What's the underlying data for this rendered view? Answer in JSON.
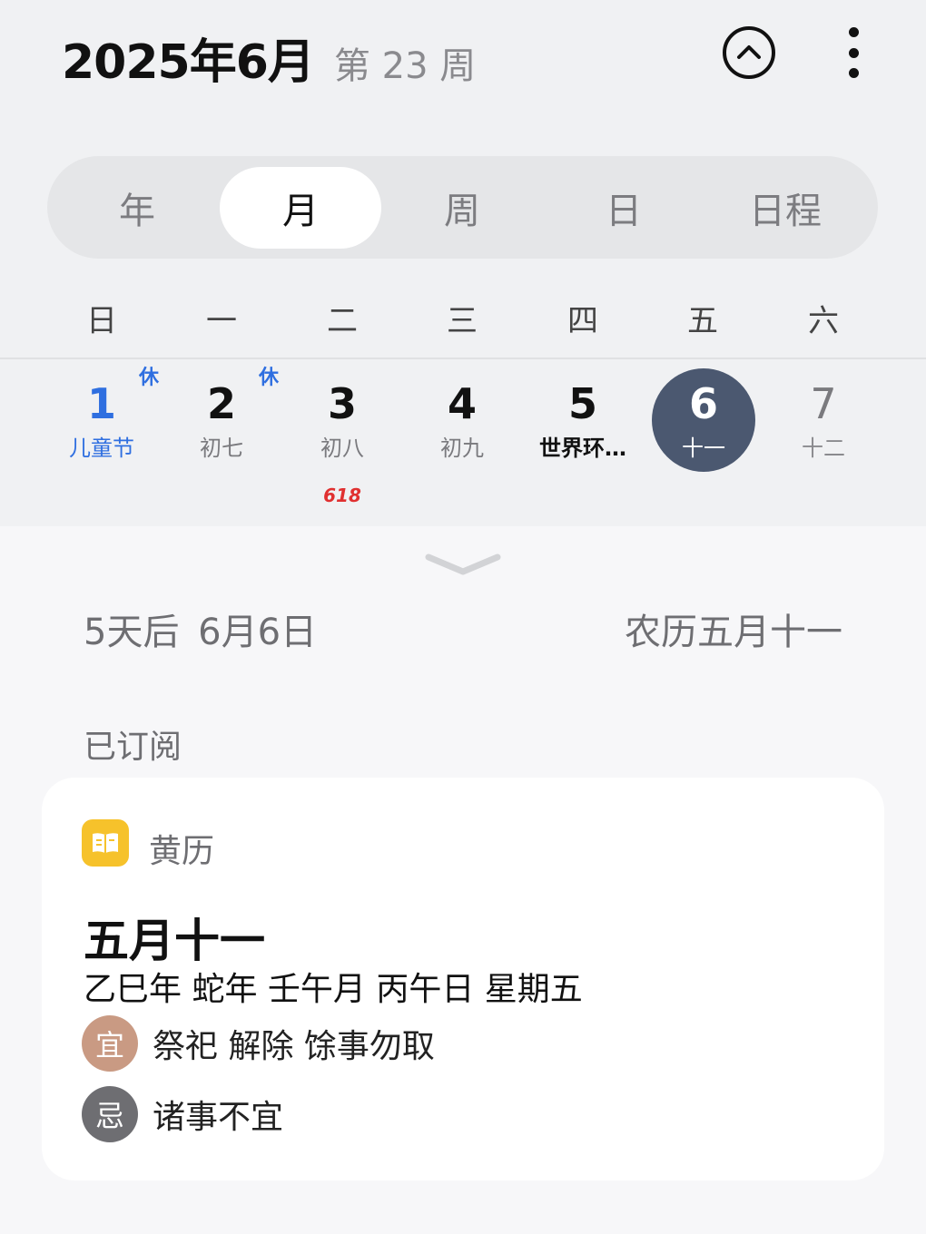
{
  "header": {
    "month_title": "2025年6月",
    "week_label": "第 23 周",
    "collapse_icon": "chevron-up-circle-icon",
    "more_icon": "more-vertical-icon"
  },
  "view_tabs": [
    {
      "label": "年",
      "active": false
    },
    {
      "label": "月",
      "active": true
    },
    {
      "label": "周",
      "active": false
    },
    {
      "label": "日",
      "active": false
    },
    {
      "label": "日程",
      "active": false
    }
  ],
  "weekdays": [
    "日",
    "一",
    "二",
    "三",
    "四",
    "五",
    "六"
  ],
  "week_days": [
    {
      "day": "1",
      "sub": "儿童节",
      "mark": "休",
      "style": "holiday"
    },
    {
      "day": "2",
      "sub": "初七",
      "mark": "休",
      "style": "normal"
    },
    {
      "day": "3",
      "sub": "初八",
      "tag": "618",
      "style": "normal"
    },
    {
      "day": "4",
      "sub": "初九",
      "style": "normal"
    },
    {
      "day": "5",
      "sub": "世界环…",
      "style": "event"
    },
    {
      "day": "6",
      "sub": "十一",
      "style": "selected"
    },
    {
      "day": "7",
      "sub": "十二",
      "style": "weekend"
    }
  ],
  "detail": {
    "countdown": "5天后  6月6日",
    "lunar": "农历五月十一",
    "subscribed_label": "已订阅"
  },
  "almanac_card": {
    "app_name": "黄历",
    "app_icon": "book-icon",
    "lunar_date": "五月十一",
    "ganzhi": "乙巳年 蛇年 壬午月 丙午日 星期五",
    "yi_badge": "宜",
    "yi_text": "祭祀 解除 馀事勿取",
    "ji_badge": "忌",
    "ji_text": "诸事不宜"
  },
  "colors": {
    "accent_blue": "#2f6fe0",
    "selected_day": "#4b5870",
    "yi_color": "#c99a83",
    "ji_color": "#6e6e72",
    "app_icon_yellow": "#f6c22b"
  }
}
